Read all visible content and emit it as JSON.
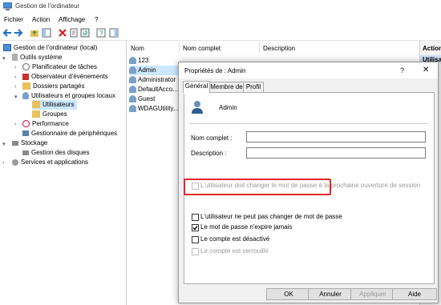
{
  "window": {
    "title": "Gestion de l'ordinateur"
  },
  "menu": {
    "items": [
      "Fichier",
      "Action",
      "Affichage",
      "?"
    ]
  },
  "tree": {
    "root": "Gestion de l'ordinateur (local)",
    "outils": "Outils système",
    "planificateur": "Planificateur de tâches",
    "observateur": "Observateur d'événements",
    "dossiers": "Dossiers partagés",
    "utilisateurs_groupes": "Utilisateurs et groupes locaux",
    "utilisateurs": "Utilisateurs",
    "groupes": "Groupes",
    "performance": "Performance",
    "gestionnaire": "Gestionnaire de périphériques",
    "stockage": "Stockage",
    "disques": "Gestion des disques",
    "services": "Services et applications"
  },
  "list": {
    "columns": [
      "Nom",
      "Nom complet",
      "Description"
    ],
    "rows": [
      "123",
      "Admin",
      "Administrator",
      "DefaultAcco...",
      "Guest",
      "WDAGUtility..."
    ]
  },
  "actions": {
    "header": "Action",
    "item": "Utilisat"
  },
  "dialog": {
    "title": "Propriétés de : Admin",
    "help": "?",
    "close": "✕",
    "tabs": [
      "Général",
      "Membre de",
      "Profil"
    ],
    "username": "Admin",
    "fullname_label": "Nom complet :",
    "fullname_value": "",
    "description_label": "Description :",
    "description_value": "",
    "options": [
      {
        "label": "L'utilisateur doit changer le mot de passe à la prochaine ouverture de session",
        "checked": false,
        "disabled": true
      },
      {
        "label": "L'utilisateur ne peut pas changer de mot de passe",
        "checked": false,
        "disabled": false
      },
      {
        "label": "Le mot de passe n'expire jamais",
        "checked": true,
        "disabled": false
      },
      {
        "label": "Le compte est désactivé",
        "checked": false,
        "disabled": false
      },
      {
        "label": "Le compte est verrouillé",
        "checked": false,
        "disabled": true
      }
    ],
    "buttons": {
      "ok": "OK",
      "cancel": "Annuler",
      "apply": "Appliquer",
      "help": "Aide"
    }
  },
  "colors": {
    "highlight": "#e3262a",
    "selection": "#cce8ff",
    "folder": "#e8c25a"
  }
}
